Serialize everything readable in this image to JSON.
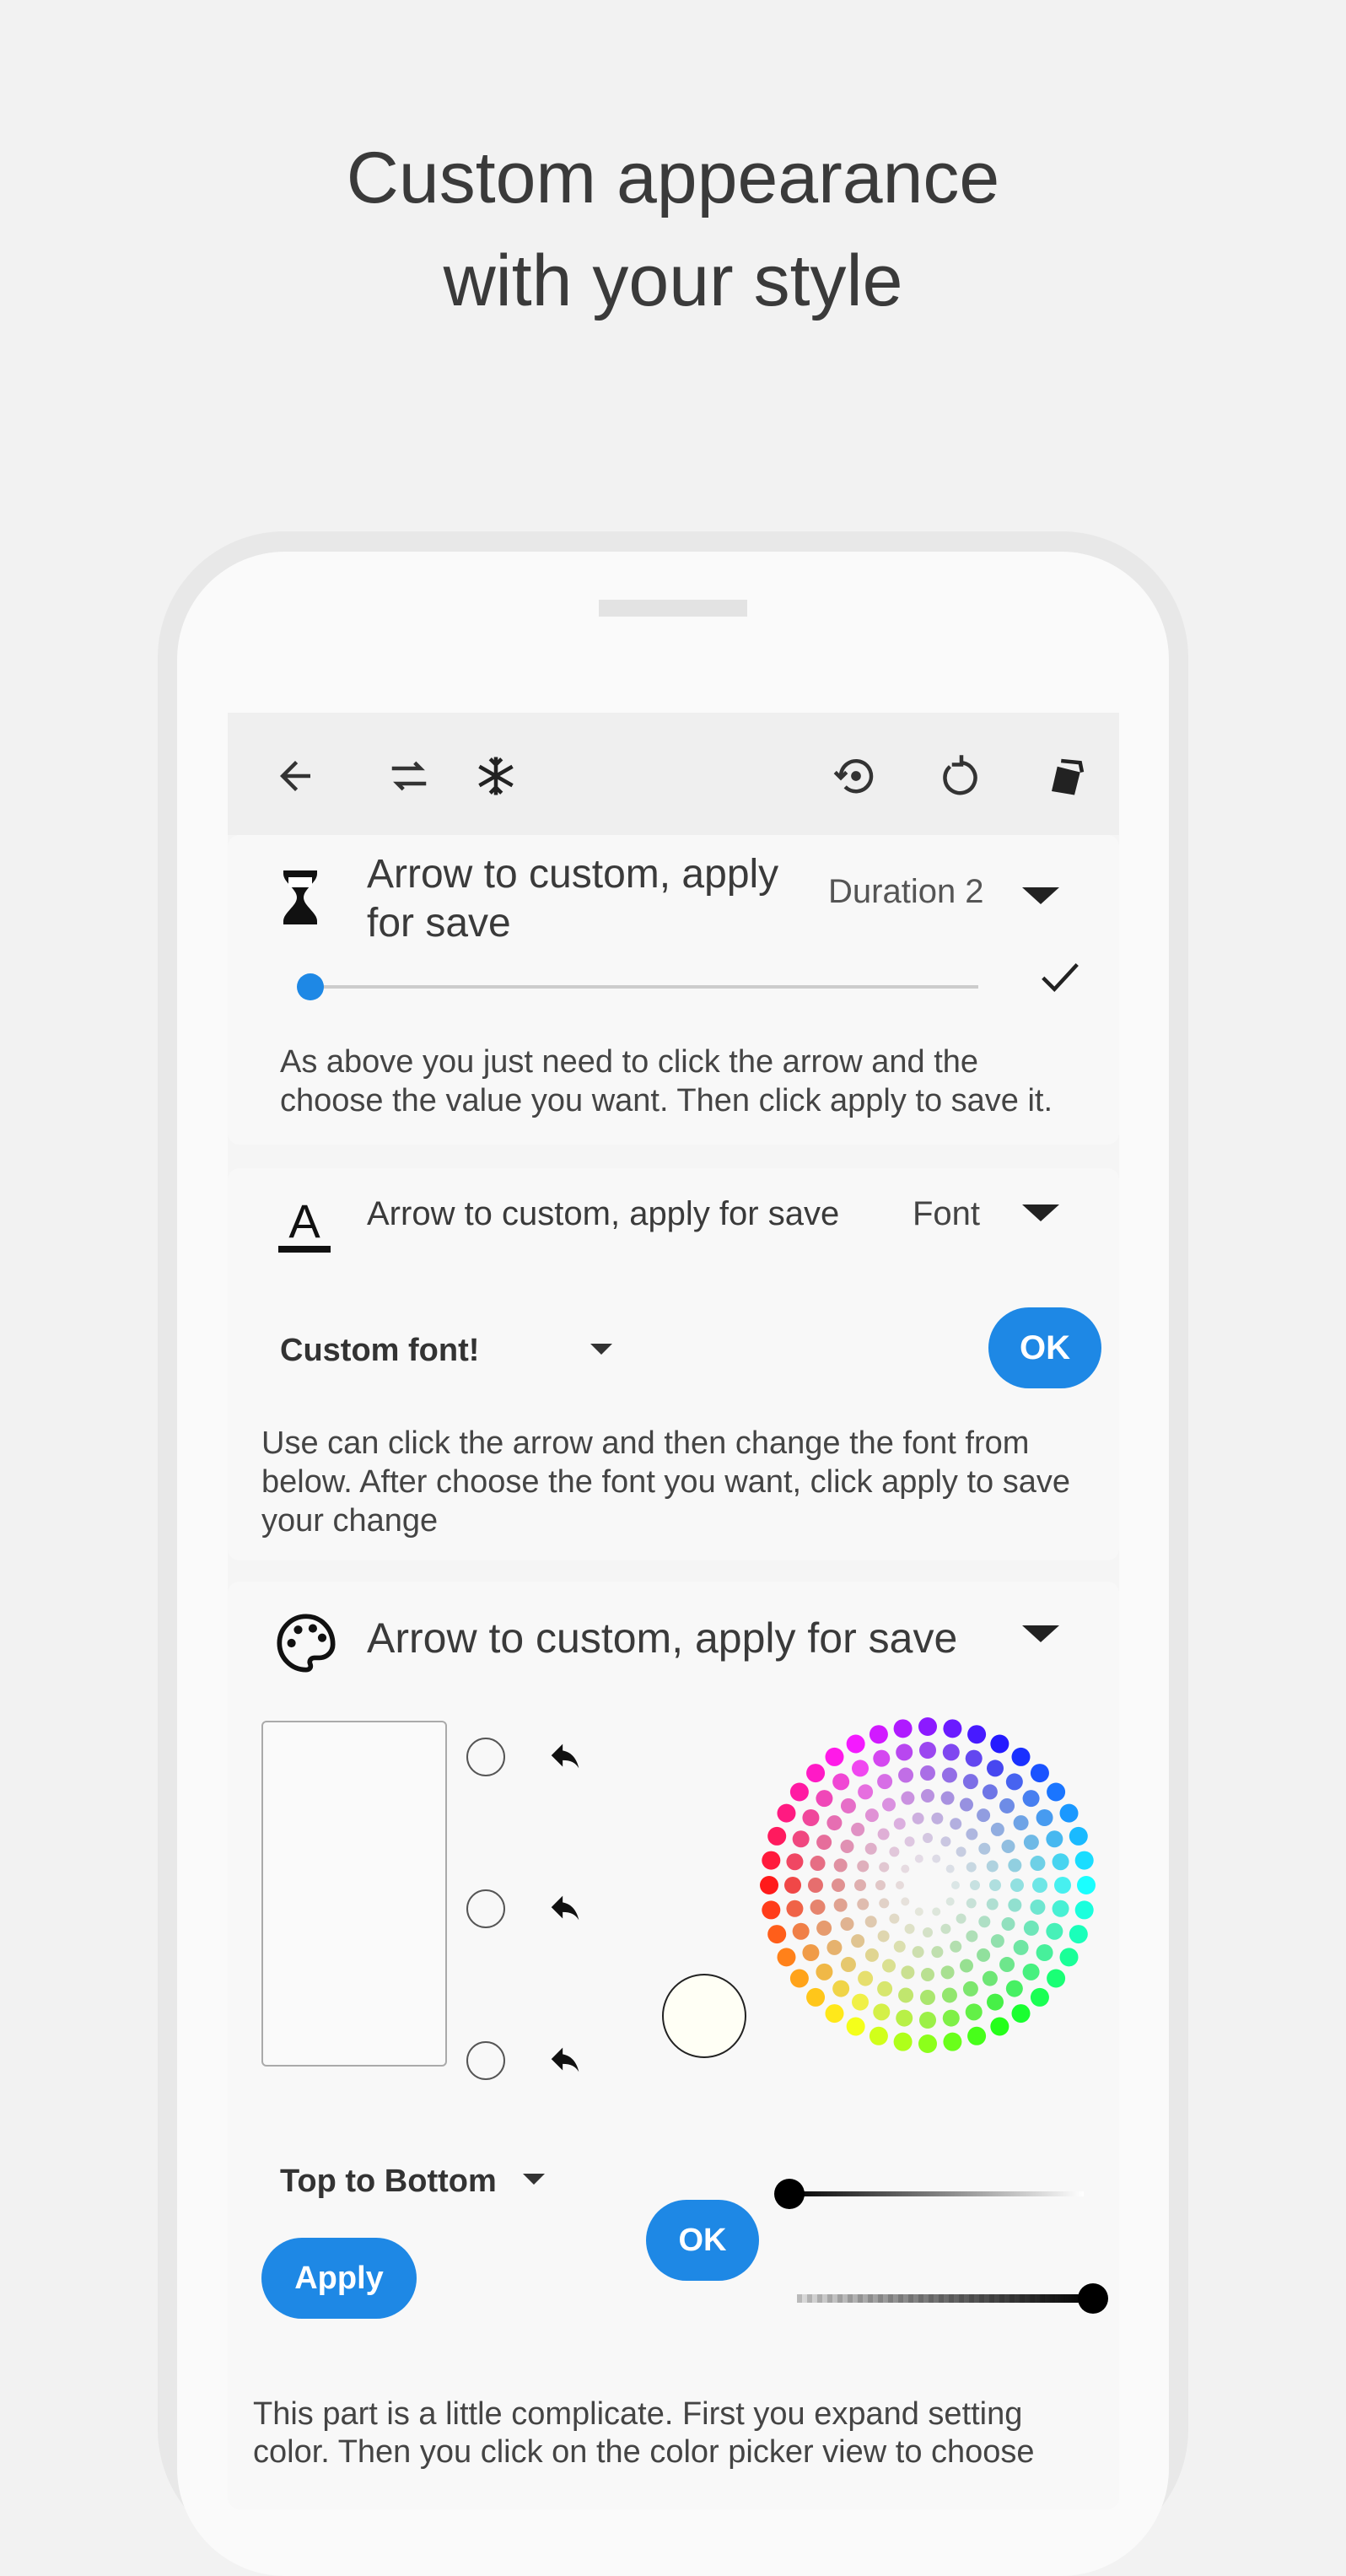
{
  "headline": {
    "line1": "Custom appearance",
    "line2": "with your style"
  },
  "toolbar": {
    "icons": [
      "back-arrow-icon",
      "swap-icon",
      "snowflake-icon",
      "history-icon",
      "refresh-icon",
      "cards-icon"
    ]
  },
  "duration_card": {
    "title": "Arrow to custom, apply for save",
    "value": "Duration 2",
    "slider_level": 0.0,
    "description": "As above you just need to click the arrow and the choose the value you want. Then click apply to save it."
  },
  "font_card": {
    "title": "Arrow to custom, apply for save",
    "value": "Font",
    "select_value": "Custom font!",
    "ok_label": "OK",
    "description": "Use can click the arrow and then change the font from below. After choose the font you want, click apply to save your change"
  },
  "color_card": {
    "title": "Arrow to custom, apply for save",
    "gradient_direction": "Top to Bottom",
    "apply_label": "Apply",
    "ok_label": "OK",
    "lightness_level": 0.0,
    "alpha_level": 1.0,
    "description": "This part is a little complicate. First you expand setting color. Then you click on the color picker view to choose"
  },
  "colors": {
    "accent": "#1e88e5",
    "slider_thumb": "#1e88e5"
  }
}
